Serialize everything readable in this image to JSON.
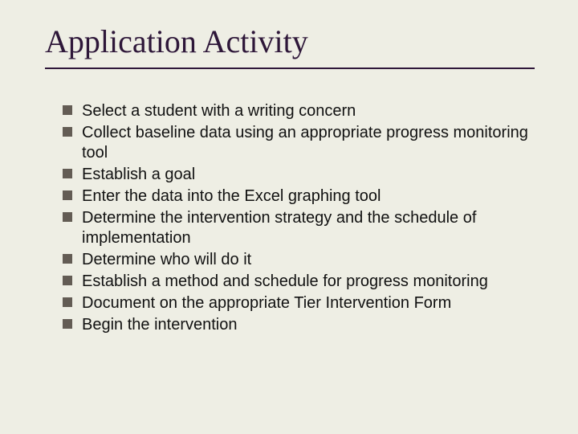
{
  "title": "Application Activity",
  "items": [
    "Select a student with a writing concern",
    "Collect baseline data using an appropriate progress monitoring tool",
    "Establish a goal",
    "Enter the data into the Excel graphing tool",
    "Determine the intervention strategy and the schedule of implementation",
    "Determine who will do it",
    "Establish a method and schedule for progress monitoring",
    "Document on the appropriate Tier Intervention Form",
    "Begin the intervention"
  ]
}
